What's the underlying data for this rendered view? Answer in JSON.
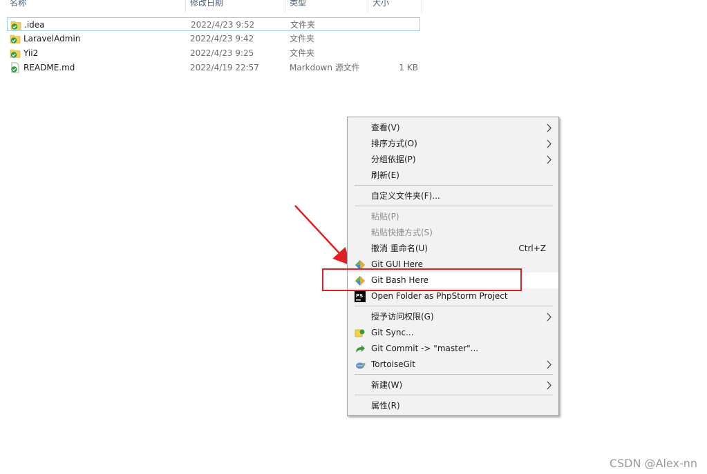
{
  "columns": {
    "name": "名称",
    "date": "修改日期",
    "type": "类型",
    "size": "大小"
  },
  "files": [
    {
      "name": ".idea",
      "date": "2022/4/23 9:52",
      "type": "文件夹",
      "size": "",
      "icon": "folder-git-ok-icon"
    },
    {
      "name": "LaravelAdmin",
      "date": "2022/4/23 9:42",
      "type": "文件夹",
      "size": "",
      "icon": "folder-git-ok-icon"
    },
    {
      "name": "Yii2",
      "date": "2022/4/23 9:25",
      "type": "文件夹",
      "size": "",
      "icon": "folder-git-ok-icon"
    },
    {
      "name": "README.md",
      "date": "2022/4/19 22:57",
      "type": "Markdown 源文件",
      "size": "1 KB",
      "icon": "file-git-ok-icon"
    }
  ],
  "context_menu": {
    "view": "查看(V)",
    "sort": "排序方式(O)",
    "group": "分组依据(P)",
    "refresh": "刷新(E)",
    "customize": "自定义文件夹(F)...",
    "paste": "粘贴(P)",
    "paste_shortcut": "粘贴快捷方式(S)",
    "undo": "撤消 重命名(U)",
    "undo_shortcut": "Ctrl+Z",
    "git_gui": "Git GUI Here",
    "git_bash": "Git Bash Here",
    "phpstorm": "Open Folder as PhpStorm Project",
    "grant_access": "授予访问权限(G)",
    "git_sync": "Git Sync...",
    "git_commit": "Git Commit -> \"master\"...",
    "tortoise": "TortoiseGit",
    "new": "新建(W)",
    "properties": "属性(R)"
  },
  "watermark": "CSDN @Alex-nn",
  "colors": {
    "annotation_red": "#e02020",
    "selection_border": "#99d1ff",
    "git_ok_green": "#2e9e3e",
    "folder_yellow": "#f5cf57"
  }
}
